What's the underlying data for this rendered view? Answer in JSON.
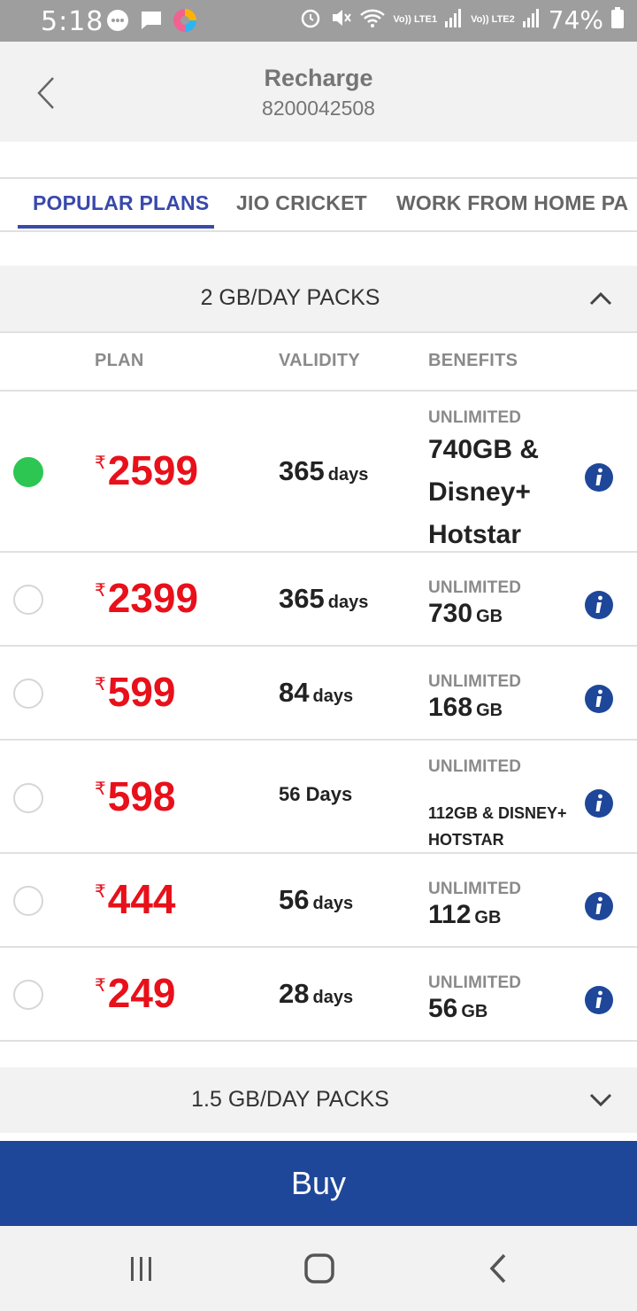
{
  "status_bar": {
    "time": "5:18",
    "signal1": "Vo)) LTE1",
    "signal2": "Vo)) LTE2",
    "battery": "74%"
  },
  "header": {
    "title": "Recharge",
    "subtitle": "8200042508"
  },
  "tabs": [
    {
      "label": "POPULAR PLANS",
      "active": true
    },
    {
      "label": "JIO CRICKET",
      "active": false
    },
    {
      "label": "WORK FROM HOME PA",
      "active": false
    }
  ],
  "section_open": {
    "title": "2 GB/DAY PACKS"
  },
  "columns": {
    "plan": "PLAN",
    "validity": "VALIDITY",
    "benefits": "BENEFITS"
  },
  "currency_symbol": "₹",
  "plans": [
    {
      "price": "2599",
      "validity_num": "365",
      "validity_unit": "days",
      "benefit_label": "UNLIMITED",
      "benefit_line1": "740GB &",
      "benefit_line2": "Disney+",
      "benefit_line3": "Hotstar",
      "selected": true
    },
    {
      "price": "2399",
      "validity_num": "365",
      "validity_unit": "days",
      "benefit_label": "UNLIMITED",
      "benefit_num": "730",
      "benefit_unit": "GB",
      "selected": false
    },
    {
      "price": "599",
      "validity_num": "84",
      "validity_unit": "days",
      "benefit_label": "UNLIMITED",
      "benefit_num": "168",
      "benefit_unit": "GB",
      "selected": false
    },
    {
      "price": "598",
      "validity_text": "56 Days",
      "benefit_label": "UNLIMITED",
      "benefit_line1": "112GB & DISNEY+",
      "benefit_line2": "HOTSTAR",
      "selected": false
    },
    {
      "price": "444",
      "validity_num": "56",
      "validity_unit": "days",
      "benefit_label": "UNLIMITED",
      "benefit_num": "112",
      "benefit_unit": "GB",
      "selected": false
    },
    {
      "price": "249",
      "validity_num": "28",
      "validity_unit": "days",
      "benefit_label": "UNLIMITED",
      "benefit_num": "56",
      "benefit_unit": "GB",
      "selected": false
    }
  ],
  "section_collapsed": {
    "title": "1.5 GB/DAY PACKS"
  },
  "buy_label": "Buy",
  "colors": {
    "accent": "#3949ab",
    "price": "#e8101a",
    "selected": "#2dc653",
    "buy": "#1e4799",
    "info": "#1e4799"
  }
}
